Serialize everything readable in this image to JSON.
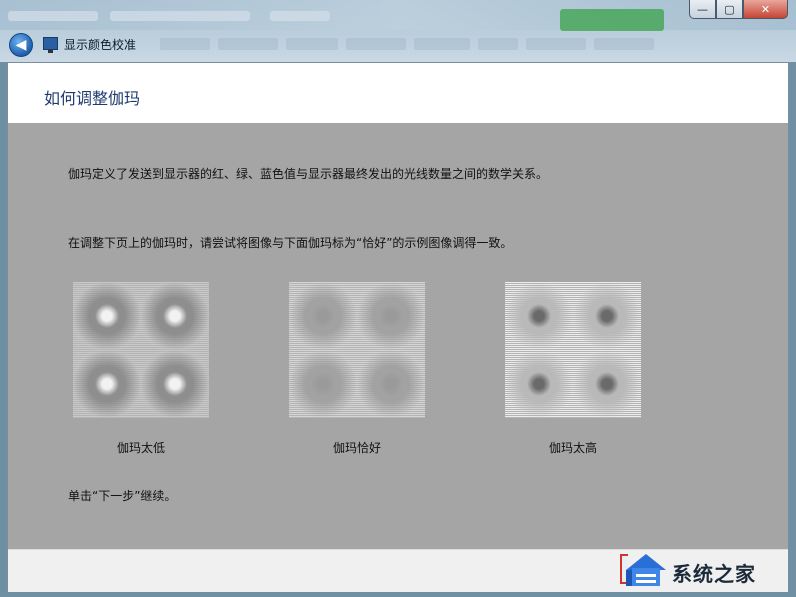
{
  "window": {
    "title": "显示颜色校准",
    "controls": {
      "minimize": "—",
      "maximize": "▢",
      "close": "✕"
    }
  },
  "page": {
    "title": "如何调整伽玛",
    "description": "伽玛定义了发送到显示器的红、绿、蓝色值与显示器最终发出的光线数量之间的数学关系。",
    "instruction": "在调整下页上的伽玛时，请尝试将图像与下面伽玛标为“恰好”的示例图像调得一致。",
    "samples": [
      {
        "label": "伽玛太低",
        "center": "#f2f2f2",
        "edge": "#8e8e8e",
        "bg": "#c9c9c9"
      },
      {
        "label": "伽玛恰好",
        "center": "#9a9a9a",
        "edge": "#a2a2a2",
        "bg": "#d5d5d5"
      },
      {
        "label": "伽玛太高",
        "center": "#6a6a6a",
        "edge": "#b9b9b9",
        "bg": "#ececec"
      }
    ],
    "continue_text": "单击“下一步”继续。"
  },
  "colors": {
    "panel_gray": "#a5a5a5",
    "title_blue": "#1e3a70"
  },
  "watermark": {
    "text": "系统之家"
  }
}
